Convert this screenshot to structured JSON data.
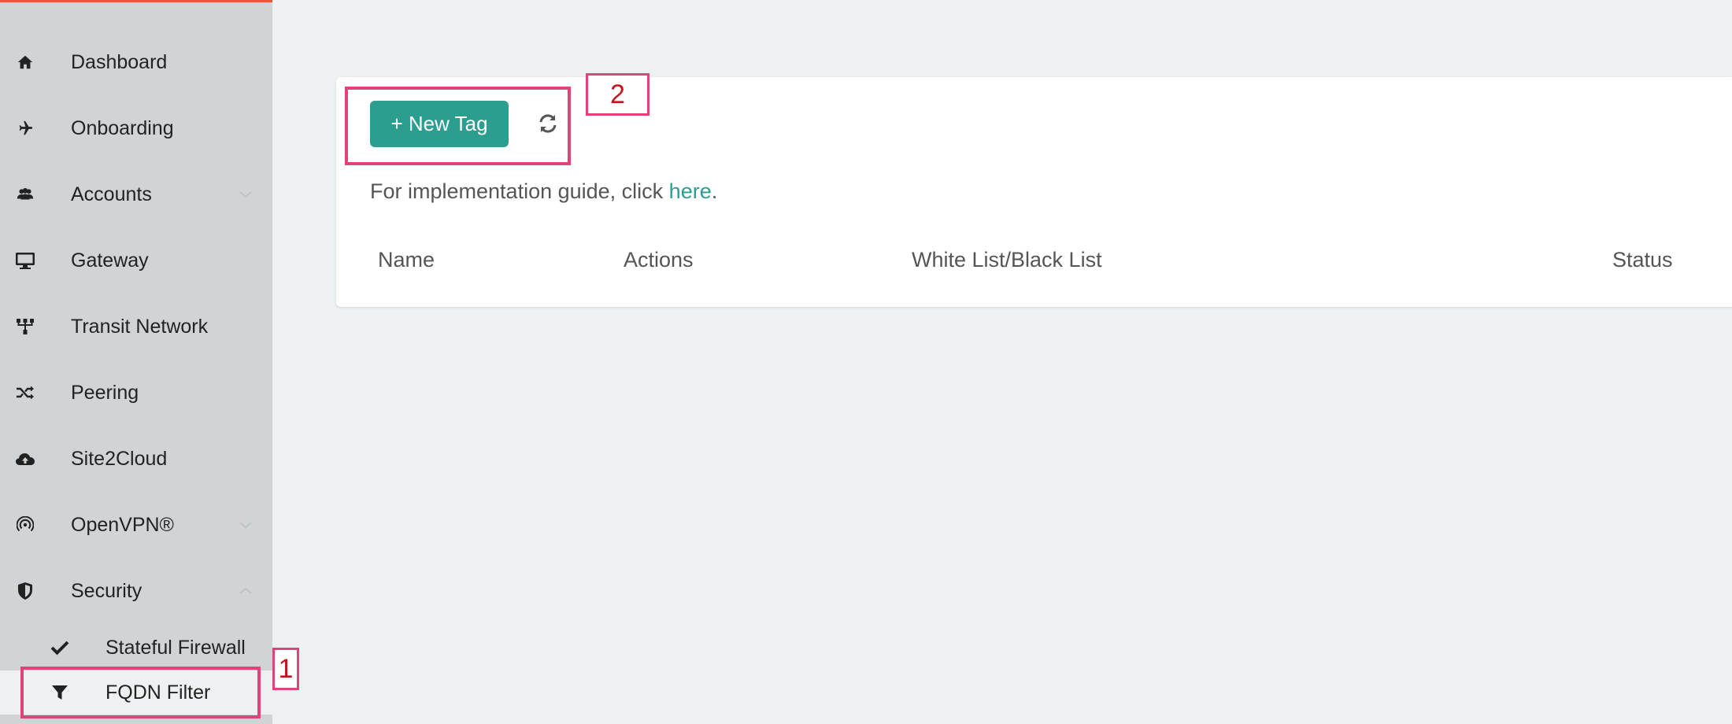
{
  "sidebar": {
    "items": [
      {
        "label": "Dashboard",
        "icon": "home-icon"
      },
      {
        "label": "Onboarding",
        "icon": "airplane-icon"
      },
      {
        "label": "Accounts",
        "icon": "users-icon",
        "chevron": "down"
      },
      {
        "label": "Gateway",
        "icon": "monitor-icon"
      },
      {
        "label": "Transit Network",
        "icon": "network-icon"
      },
      {
        "label": "Peering",
        "icon": "shuffle-icon"
      },
      {
        "label": "Site2Cloud",
        "icon": "cloud-upload-icon"
      },
      {
        "label": "OpenVPN®",
        "icon": "signal-icon",
        "chevron": "down"
      },
      {
        "label": "Security",
        "icon": "shield-icon",
        "chevron": "up"
      }
    ],
    "sub_items": [
      {
        "label": "Stateful Firewall",
        "icon": "check-icon"
      },
      {
        "label": "FQDN Filter",
        "icon": "filter-icon",
        "active": true
      }
    ]
  },
  "annotations": {
    "marker_1": "1",
    "marker_2": "2"
  },
  "toolbar": {
    "new_tag_label": "+ New Tag",
    "refresh_icon": "refresh-icon"
  },
  "guide": {
    "prefix": "For implementation guide, click ",
    "link": "here",
    "suffix": "."
  },
  "table": {
    "columns": [
      "Name",
      "Actions",
      "White List/Black List",
      "Status"
    ]
  },
  "colors": {
    "accent": "#2c9e8f",
    "sidebar_bg": "#d0d4d6",
    "highlight": "#e0437a",
    "marker_text": "#c4161c"
  }
}
